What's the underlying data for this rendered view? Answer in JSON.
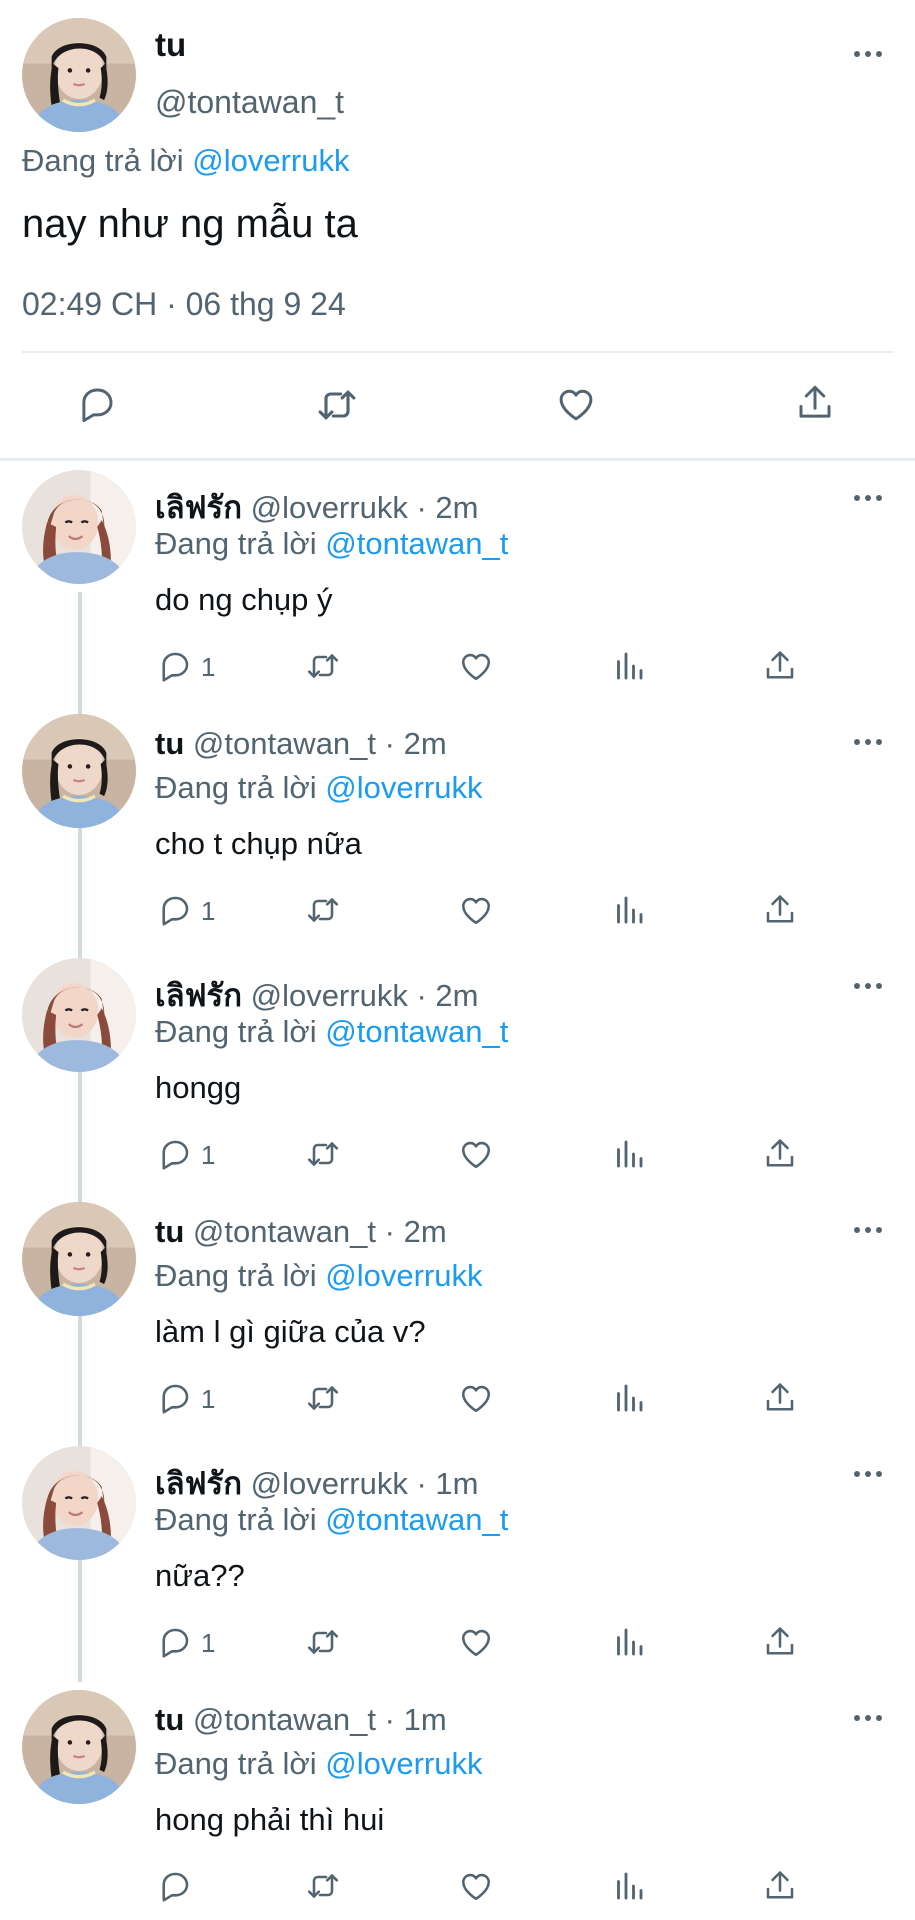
{
  "main_tweet": {
    "name": "tu",
    "handle": "@tontawan_t",
    "replying_prefix": "Đang trả lời",
    "replying_to": "@loverrukk",
    "text": "nay như ng mẫu ta",
    "timestamp": "02:49 CH · 06 thg 9 24",
    "avatar_icon": "profile-photo-tu"
  },
  "replies": [
    {
      "name": "เลิฟรัก",
      "handle": "@loverrukk",
      "time": "· 2m",
      "replying_prefix": "Đang trả lời",
      "replying_to": "@tontawan_t",
      "text": "do ng chụp ý",
      "reply_count": "1",
      "avatar_icon": "profile-photo-loverrukk"
    },
    {
      "name": "tu",
      "handle": "@tontawan_t",
      "time": "· 2m",
      "replying_prefix": "Đang trả lời",
      "replying_to": "@loverrukk",
      "text": "cho t chụp nữa",
      "reply_count": "1",
      "avatar_icon": "profile-photo-tu"
    },
    {
      "name": "เลิฟรัก",
      "handle": "@loverrukk",
      "time": "· 2m",
      "replying_prefix": "Đang trả lời",
      "replying_to": "@tontawan_t",
      "text": "hongg",
      "reply_count": "1",
      "avatar_icon": "profile-photo-loverrukk"
    },
    {
      "name": "tu",
      "handle": "@tontawan_t",
      "time": "· 2m",
      "replying_prefix": "Đang trả lời",
      "replying_to": "@loverrukk",
      "text": "làm l gì giữa của v?",
      "reply_count": "1",
      "avatar_icon": "profile-photo-tu"
    },
    {
      "name": "เลิฟรัก",
      "handle": "@loverrukk",
      "time": "· 1m",
      "replying_prefix": "Đang trả lời",
      "replying_to": "@tontawan_t",
      "text": "nữa??",
      "reply_count": "1",
      "avatar_icon": "profile-photo-loverrukk"
    },
    {
      "name": "tu",
      "handle": "@tontawan_t",
      "time": "· 1m",
      "replying_prefix": "Đang trả lời",
      "replying_to": "@loverrukk",
      "text": "hong phải thì hui",
      "reply_count": "",
      "avatar_icon": "profile-photo-tu"
    }
  ],
  "colors": {
    "text": "#0f1419",
    "secondary": "#536471",
    "link": "#1d9bf0",
    "divider": "#e6ecf0",
    "thread_line": "#cfd9de"
  }
}
